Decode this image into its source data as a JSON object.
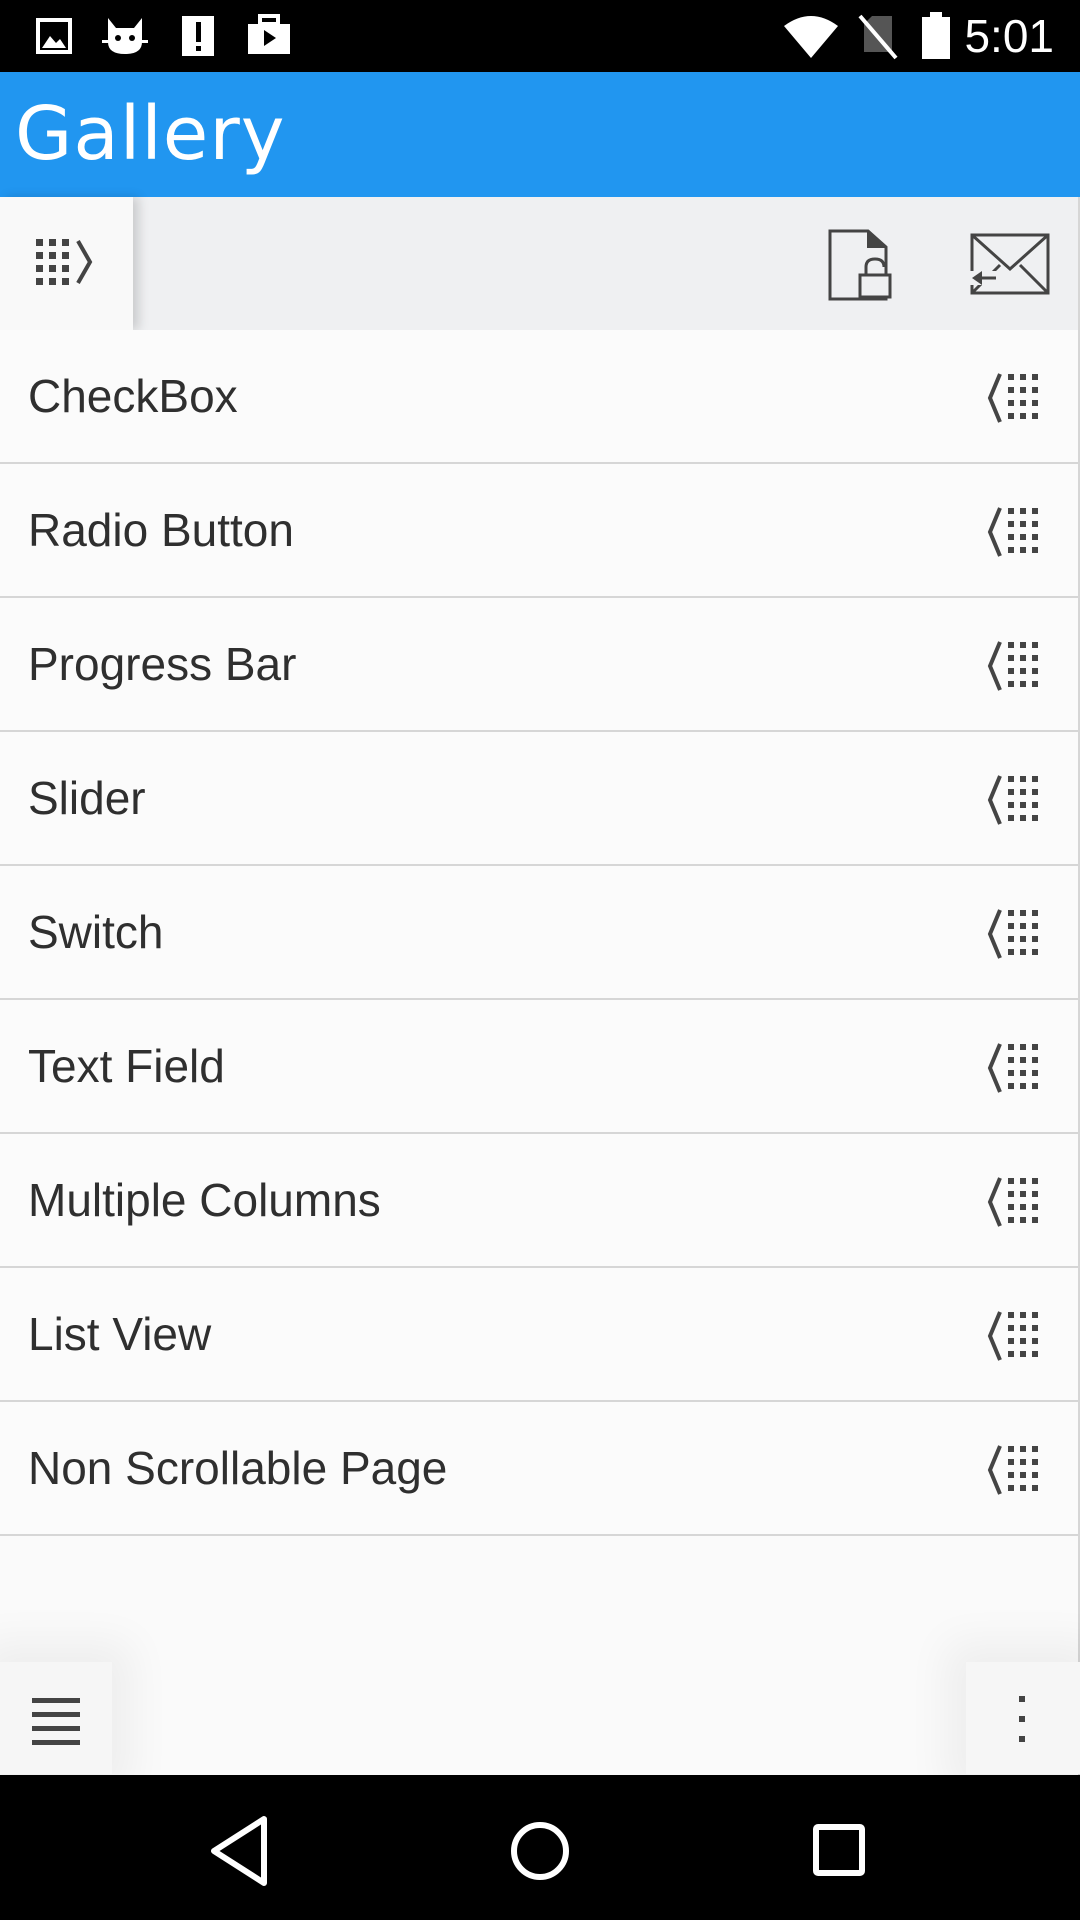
{
  "status_bar": {
    "time": "5:01",
    "icons": [
      "image-icon",
      "cat-icon",
      "alert-icon",
      "work-icon",
      "wifi-icon",
      "no-sim-icon",
      "battery-icon"
    ]
  },
  "app_bar": {
    "title": "Gallery",
    "color": "#2196f0"
  },
  "toolbar": {
    "icons": [
      "drawer-toggle-icon",
      "lock-file-icon",
      "mail-icon"
    ]
  },
  "list": {
    "items": [
      {
        "label": "CheckBox"
      },
      {
        "label": "Radio Button"
      },
      {
        "label": "Progress Bar"
      },
      {
        "label": "Slider"
      },
      {
        "label": "Switch"
      },
      {
        "label": "Text Field"
      },
      {
        "label": "Multiple Columns"
      },
      {
        "label": "List View"
      },
      {
        "label": "Non Scrollable Page"
      }
    ],
    "row_icon": "grid-chevron-icon"
  },
  "bottom": {
    "icons": [
      "menu-icon",
      "more-vert-icon"
    ]
  },
  "nav_bar": {
    "icons": [
      "back-icon",
      "home-icon",
      "recents-icon"
    ]
  }
}
